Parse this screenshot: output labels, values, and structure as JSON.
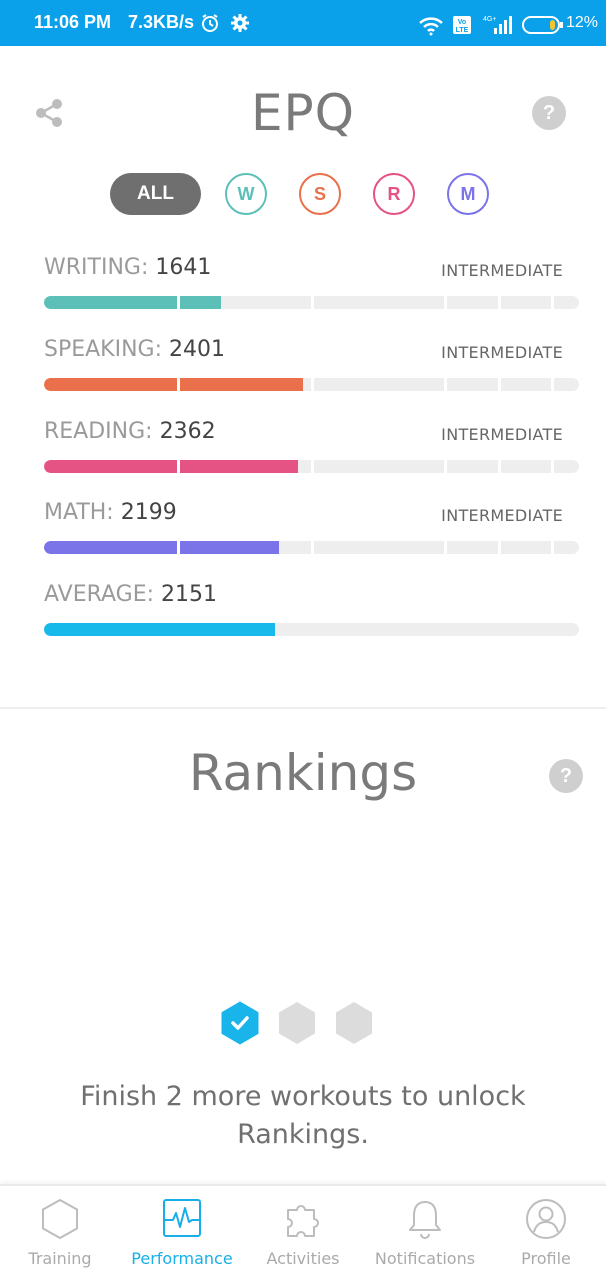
{
  "status_bar": {
    "time": "11:06 PM",
    "net_speed": "7.3KB/s",
    "battery": "12%",
    "network": "4G+"
  },
  "epq": {
    "title": "EPQ",
    "help": "?"
  },
  "filters": [
    {
      "label": "ALL",
      "active": true
    },
    {
      "label": "W",
      "color": "#5cc0b8"
    },
    {
      "label": "S",
      "color": "#e9704a"
    },
    {
      "label": "R",
      "color": "#e55384"
    },
    {
      "label": "M",
      "color": "#7b73e8"
    }
  ],
  "skills": [
    {
      "label": "WRITING:",
      "value": "1641",
      "level": "INTERMEDIATE",
      "color": "#5cc0b8",
      "progress": 0.33
    },
    {
      "label": "SPEAKING:",
      "value": "2401",
      "level": "INTERMEDIATE",
      "color": "#e9704a",
      "progress": 0.485
    },
    {
      "label": "READING:",
      "value": "2362",
      "level": "INTERMEDIATE",
      "color": "#e55384",
      "progress": 0.475
    },
    {
      "label": "MATH:",
      "value": "2199",
      "level": "INTERMEDIATE",
      "color": "#7b73e8",
      "progress": 0.44
    },
    {
      "label": "AVERAGE:",
      "value": "2151",
      "level": "",
      "color": "#17b9ea",
      "progress": 0.432
    }
  ],
  "rankings": {
    "title": "Rankings",
    "help": "?",
    "unlock_line1": "Finish 2 more workouts to unlock",
    "unlock_line2": "Rankings.",
    "workouts_done": 1,
    "workouts_total": 3
  },
  "nav": {
    "training": "Training",
    "performance": "Performance",
    "activities": "Activities",
    "notifications": "Notifications",
    "profile": "Profile",
    "active_color": "#18aee8"
  }
}
